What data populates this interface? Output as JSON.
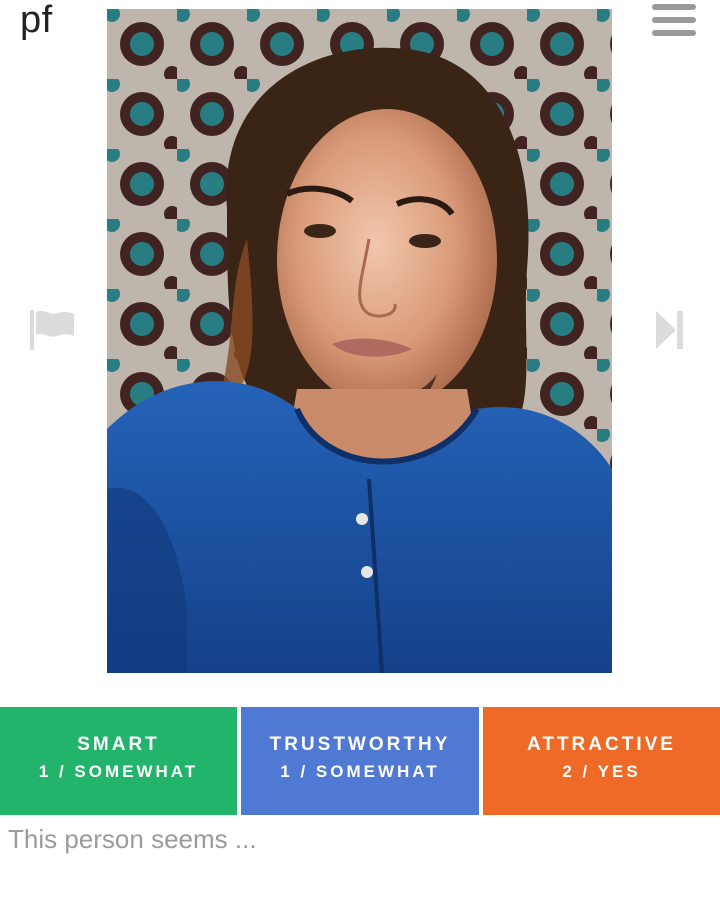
{
  "header": {
    "logo_text": "pf",
    "menu_icon": "hamburger-menu-icon"
  },
  "navigation": {
    "flag_icon": "flag-icon",
    "next_icon": "skip-next-icon"
  },
  "photo": {
    "subject": "portrait photo of a young man with long hair in a blue henley shirt"
  },
  "ratings": [
    {
      "label": "SMART",
      "value": "1 / SOMEWHAT",
      "color": "#22b46b"
    },
    {
      "label": "TRUSTWORTHY",
      "value": "1 / SOMEWHAT",
      "color": "#4f79d3"
    },
    {
      "label": "ATTRACTIVE",
      "value": "2 / YES",
      "color": "#ee6a26"
    }
  ],
  "prompt": {
    "text": "This person seems ..."
  }
}
